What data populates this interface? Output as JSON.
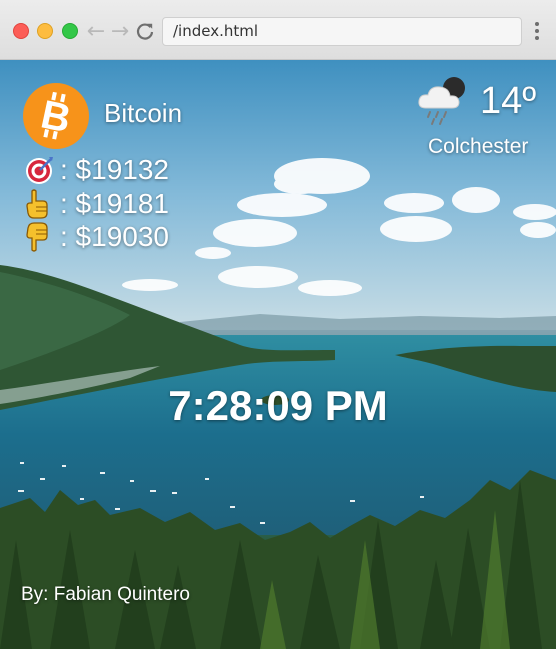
{
  "browser": {
    "url": "/index.html"
  },
  "coin": {
    "name": "Bitcoin",
    "logo_icon": "bitcoin-icon",
    "logo_color": "#f7931a"
  },
  "prices": [
    {
      "icon": "target-icon",
      "label": ": $19132"
    },
    {
      "icon": "hand-pointing-up-icon",
      "label": ": $19181"
    },
    {
      "icon": "hand-pointing-down-icon",
      "label": ": $19030"
    }
  ],
  "weather": {
    "icon": "rain-cloud-night-icon",
    "temperature": "14º",
    "location": "Colchester"
  },
  "clock": {
    "time": "7:28:09 PM"
  },
  "footer": {
    "author": "By: Fabian Quintero"
  }
}
